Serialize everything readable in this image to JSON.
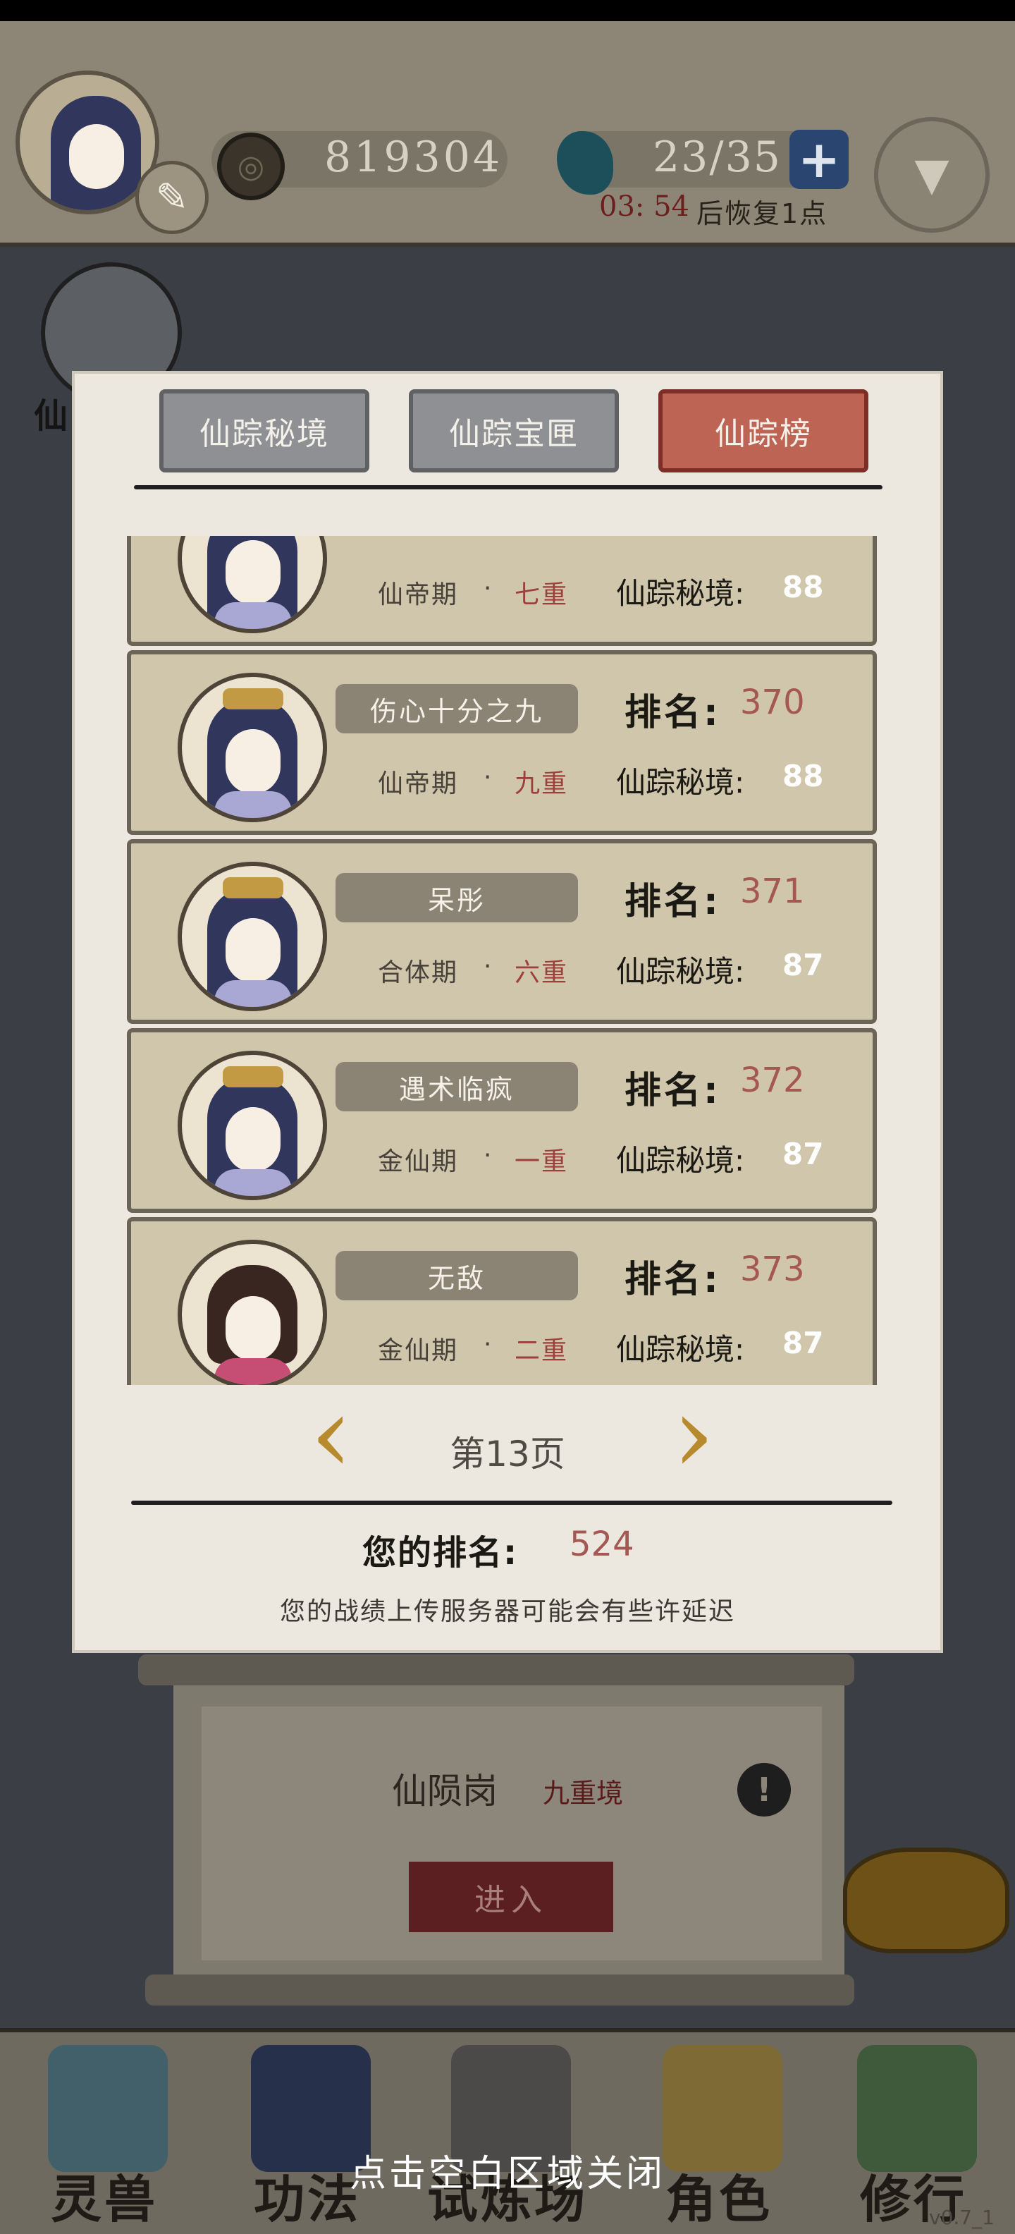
{
  "header": {
    "coins": "819304",
    "energy": "23/35",
    "recover_time": "03: 54",
    "recover_text": "后恢复1点"
  },
  "background": {
    "side_label": "仙",
    "dungeon_name": "仙陨岗",
    "dungeon_level": "九重境",
    "enter_label": "进入"
  },
  "tabs": [
    {
      "label": "仙踪秘境",
      "active": false
    },
    {
      "label": "仙踪宝匣",
      "active": false
    },
    {
      "label": "仙踪榜",
      "active": true
    }
  ],
  "rank_prefix": "排名:",
  "score_prefix": "仙踪秘境:",
  "realm_separator": "·",
  "entries": [
    {
      "name": "",
      "rank": "",
      "realm": "仙帝期",
      "layer": "七重",
      "score": "88",
      "avatar": "female-blue-hair"
    },
    {
      "name": "伤心十分之九",
      "rank": "370",
      "realm": "仙帝期",
      "layer": "九重",
      "score": "88",
      "avatar": "female-blue-hair"
    },
    {
      "name": "呆彤",
      "rank": "371",
      "realm": "合体期",
      "layer": "六重",
      "score": "87",
      "avatar": "female-blue-hair"
    },
    {
      "name": "遇术临疯",
      "rank": "372",
      "realm": "金仙期",
      "layer": "一重",
      "score": "87",
      "avatar": "female-blue-hair"
    },
    {
      "name": "无敌",
      "rank": "373",
      "realm": "金仙期",
      "layer": "二重",
      "score": "87",
      "avatar": "female-brown-hair"
    }
  ],
  "pager": {
    "page_label": "第13页"
  },
  "my_rank": {
    "label": "您的排名:",
    "value": "524"
  },
  "notice": "您的战绩上传服务器可能会有些许延迟",
  "bottom_nav": [
    {
      "label": "灵兽"
    },
    {
      "label": "功法"
    },
    {
      "label": "试炼场"
    },
    {
      "label": "角色"
    },
    {
      "label": "修行"
    }
  ],
  "close_hint": "点击空白区域关闭",
  "version": "v0.7_1",
  "colors": {
    "accent_red": "#be6455",
    "rank_red": "#a55752",
    "layer_red": "#9d3f3b",
    "gold_arrow": "#b78a2e"
  }
}
